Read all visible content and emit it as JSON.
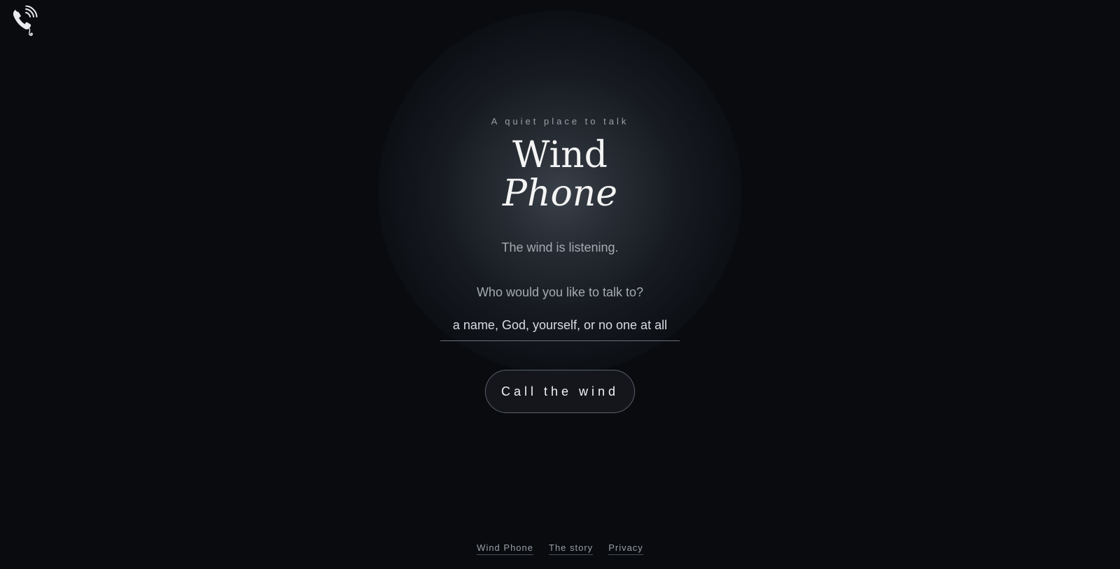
{
  "header": {
    "logo_icon": "phone-wind-icon"
  },
  "hero": {
    "tagline": "A quiet place to talk",
    "title_line1": "Wind",
    "title_line2": "Phone",
    "subtitle": "The wind is listening."
  },
  "form": {
    "prompt": "Who would you like to talk to?",
    "recipient_placeholder": "a name, God, yourself, or no one at all",
    "recipient_value": "",
    "call_button_label": "Call the wind"
  },
  "footer": {
    "links": [
      {
        "label": "Wind Phone"
      },
      {
        "label": "The story"
      },
      {
        "label": "Privacy"
      }
    ]
  },
  "colors": {
    "background": "#090b0f",
    "glow": "#3a4049",
    "text_primary": "#f4f4f4",
    "text_muted": "#a4aab2"
  }
}
